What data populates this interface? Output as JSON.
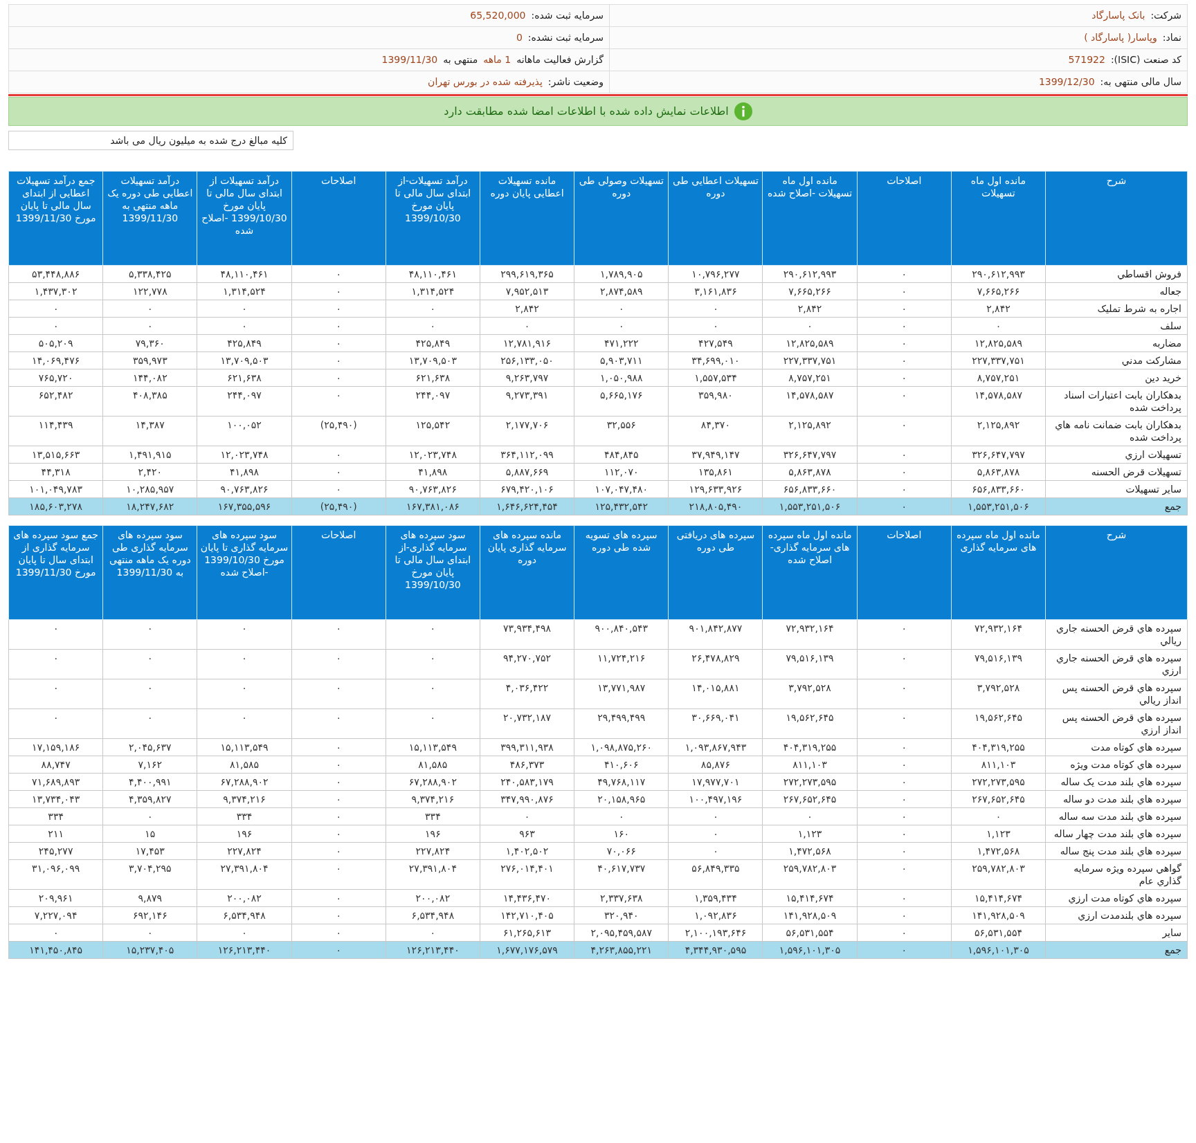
{
  "info": {
    "rows": [
      {
        "right": {
          "label": "شرکت:",
          "parts": [
            {
              "text": "بانک پاسارگاد",
              "emphasis": true
            }
          ]
        },
        "left": {
          "label": "سرمایه ثبت شده:",
          "parts": [
            {
              "text": "65,520,000",
              "emphasis": true
            }
          ]
        }
      },
      {
        "right": {
          "label": "نماد:",
          "parts": [
            {
              "text": "وپاسار( پاسارگاد )",
              "emphasis": true
            }
          ]
        },
        "left": {
          "label": "سرمایه ثبت نشده:",
          "parts": [
            {
              "text": "0",
              "emphasis": true
            }
          ]
        }
      },
      {
        "right": {
          "label": "کد صنعت (ISIC):",
          "parts": [
            {
              "text": "571922",
              "emphasis": true
            }
          ]
        },
        "left": {
          "parts": [
            {
              "text": "گزارش فعالیت ماهانه",
              "emphasis": false
            },
            {
              "text": "1 ماهه",
              "emphasis": true
            },
            {
              "text": "منتهی به",
              "emphasis": false
            },
            {
              "text": "1399/11/30",
              "emphasis": true
            }
          ]
        }
      },
      {
        "right": {
          "label": "سال مالی منتهی به:",
          "parts": [
            {
              "text": "1399/12/30",
              "emphasis": true
            }
          ]
        },
        "left": {
          "label": "وضعیت ناشر:",
          "parts": [
            {
              "text": "پذیرفته شده در بورس تهران",
              "emphasis": true
            }
          ]
        }
      }
    ]
  },
  "banner": {
    "text": "اطلاعات نمایش داده شده با اطلاعات امضا شده مطابقت دارد"
  },
  "note": "کلیه مبالغ درج شده به میلیون ریال می باشد",
  "tables": [
    {
      "columns": [
        "شرح",
        "مانده اول ماه تسهیلات",
        "اصلاحات",
        "مانده اول ماه تسهیلات -اصلاح شده",
        "تسهیلات اعطایی طی دوره",
        "تسهیلات وصولی طی دوره",
        "مانده تسهیلات اعطایی پایان دوره",
        "درآمد تسهیلات-از ابتدای سال مالی تا پایان مورخ 1399/10/30",
        "اصلاحات",
        "درآمد تسهیلات از ابتدای سال مالی تا پایان مورخ 1399/10/30 -اصلاح شده",
        "درآمد تسهیلات اعطایی طی دوره یک ماهه منتهی به 1399/11/30",
        "جمع درآمد تسهیلات اعطایی از ابتدای سال مالی تا پایان مورخ 1399/11/30"
      ],
      "rows": [
        {
          "kind": "data",
          "cells": [
            "فروش اقساطي",
            "۲۹۰,۶۱۲,۹۹۳",
            "۰",
            "۲۹۰,۶۱۲,۹۹۳",
            "۱۰,۷۹۶,۲۷۷",
            "۱,۷۸۹,۹۰۵",
            "۲۹۹,۶۱۹,۳۶۵",
            "۴۸,۱۱۰,۴۶۱",
            "۰",
            "۴۸,۱۱۰,۴۶۱",
            "۵,۳۳۸,۴۲۵",
            "۵۳,۴۴۸,۸۸۶"
          ]
        },
        {
          "kind": "data",
          "cells": [
            "جعاله",
            "۷,۶۶۵,۲۶۶",
            "۰",
            "۷,۶۶۵,۲۶۶",
            "۳,۱۶۱,۸۳۶",
            "۲,۸۷۴,۵۸۹",
            "۷,۹۵۲,۵۱۳",
            "۱,۳۱۴,۵۲۴",
            "۰",
            "۱,۳۱۴,۵۲۴",
            "۱۲۲,۷۷۸",
            "۱,۴۳۷,۳۰۲"
          ]
        },
        {
          "kind": "data",
          "cells": [
            "اجاره به شرط تمليک",
            "۲,۸۴۲",
            "۰",
            "۲,۸۴۲",
            "۰",
            "۰",
            "۲,۸۴۲",
            "۰",
            "۰",
            "۰",
            "۰",
            "۰"
          ]
        },
        {
          "kind": "data",
          "cells": [
            "سلف",
            "۰",
            "۰",
            "۰",
            "۰",
            "۰",
            "۰",
            "۰",
            "۰",
            "۰",
            "۰",
            "۰"
          ]
        },
        {
          "kind": "data",
          "cells": [
            "مضاربه",
            "۱۲,۸۲۵,۵۸۹",
            "۰",
            "۱۲,۸۲۵,۵۸۹",
            "۴۲۷,۵۴۹",
            "۴۷۱,۲۲۲",
            "۱۲,۷۸۱,۹۱۶",
            "۴۲۵,۸۴۹",
            "۰",
            "۴۲۵,۸۴۹",
            "۷۹,۳۶۰",
            "۵۰۵,۲۰۹"
          ]
        },
        {
          "kind": "data",
          "cells": [
            "مشارکت مدني",
            "۲۲۷,۳۳۷,۷۵۱",
            "۰",
            "۲۲۷,۳۳۷,۷۵۱",
            "۳۴,۶۹۹,۰۱۰",
            "۵,۹۰۳,۷۱۱",
            "۲۵۶,۱۳۳,۰۵۰",
            "۱۳,۷۰۹,۵۰۳",
            "۰",
            "۱۳,۷۰۹,۵۰۳",
            "۳۵۹,۹۷۳",
            "۱۴,۰۶۹,۴۷۶"
          ]
        },
        {
          "kind": "data",
          "cells": [
            "خريد دين",
            "۸,۷۵۷,۲۵۱",
            "۰",
            "۸,۷۵۷,۲۵۱",
            "۱,۵۵۷,۵۳۴",
            "۱,۰۵۰,۹۸۸",
            "۹,۲۶۳,۷۹۷",
            "۶۲۱,۶۳۸",
            "۰",
            "۶۲۱,۶۳۸",
            "۱۴۴,۰۸۲",
            "۷۶۵,۷۲۰"
          ]
        },
        {
          "kind": "data",
          "cells": [
            "بدهکاران بابت اعتبارات اسناد پرداخت شده",
            "۱۴,۵۷۸,۵۸۷",
            "۰",
            "۱۴,۵۷۸,۵۸۷",
            "۳۵۹,۹۸۰",
            "۵,۶۶۵,۱۷۶",
            "۹,۲۷۳,۳۹۱",
            "۲۴۴,۰۹۷",
            "۰",
            "۲۴۴,۰۹۷",
            "۴۰۸,۳۸۵",
            "۶۵۲,۴۸۲"
          ]
        },
        {
          "kind": "data",
          "cells": [
            "بدهکاران بابت ضمانت نامه هاي پرداخت شده",
            "۲,۱۲۵,۸۹۲",
            "۰",
            "۲,۱۲۵,۸۹۲",
            "۸۴,۳۷۰",
            "۳۲,۵۵۶",
            "۲,۱۷۷,۷۰۶",
            "۱۲۵,۵۴۲",
            "(۲۵,۴۹۰)",
            "۱۰۰,۰۵۲",
            "۱۴,۳۸۷",
            "۱۱۴,۴۳۹"
          ]
        },
        {
          "kind": "data",
          "cells": [
            "تسهيلات ارزي",
            "۳۲۶,۶۴۷,۷۹۷",
            "۰",
            "۳۲۶,۶۴۷,۷۹۷",
            "۳۷,۹۴۹,۱۴۷",
            "۴۸۴,۸۴۵",
            "۳۶۴,۱۱۲,۰۹۹",
            "۱۲,۰۲۳,۷۴۸",
            "۰",
            "۱۲,۰۲۳,۷۴۸",
            "۱,۴۹۱,۹۱۵",
            "۱۳,۵۱۵,۶۶۳"
          ]
        },
        {
          "kind": "data",
          "cells": [
            "تسهيلات قرض الحسنه",
            "۵,۸۶۳,۸۷۸",
            "۰",
            "۵,۸۶۳,۸۷۸",
            "۱۳۵,۸۶۱",
            "۱۱۲,۰۷۰",
            "۵,۸۸۷,۶۶۹",
            "۴۱,۸۹۸",
            "۰",
            "۴۱,۸۹۸",
            "۲,۴۲۰",
            "۴۴,۳۱۸"
          ]
        },
        {
          "kind": "data",
          "cells": [
            "ساير تسهيلات",
            "۶۵۶,۸۳۳,۶۶۰",
            "۰",
            "۶۵۶,۸۳۳,۶۶۰",
            "۱۲۹,۶۳۳,۹۲۶",
            "۱۰۷,۰۴۷,۴۸۰",
            "۶۷۹,۴۲۰,۱۰۶",
            "۹۰,۷۶۳,۸۲۶",
            "۰",
            "۹۰,۷۶۳,۸۲۶",
            "۱۰,۲۸۵,۹۵۷",
            "۱۰۱,۰۴۹,۷۸۳"
          ]
        },
        {
          "kind": "total",
          "cells": [
            "جمع",
            "۱,۵۵۳,۲۵۱,۵۰۶",
            "۰",
            "۱,۵۵۳,۲۵۱,۵۰۶",
            "۲۱۸,۸۰۵,۴۹۰",
            "۱۲۵,۴۳۲,۵۴۲",
            "۱,۶۴۶,۶۲۴,۴۵۴",
            "۱۶۷,۳۸۱,۰۸۶",
            "(۲۵,۴۹۰)",
            "۱۶۷,۳۵۵,۵۹۶",
            "۱۸,۲۴۷,۶۸۲",
            "۱۸۵,۶۰۳,۲۷۸"
          ]
        }
      ]
    },
    {
      "columns": [
        "شرح",
        "مانده اول ماه سپرده های سرمایه گذاری",
        "اصلاحات",
        "مانده اول ماه سپرده های سرمایه گذاری-اصلاح شده",
        "سپرده های دریافتی طی دوره",
        "سپرده های تسویه شده طی دوره",
        "مانده سپرده های سرمایه گذاری پایان دوره",
        "سود سپرده های سرمایه گذاری-از ابتدای سال مالی تا پایان مورخ 1399/10/30",
        "اصلاحات",
        "سود سپرده های سرمایه گذاری تا پایان مورخ 1399/10/30 -اصلاح شده",
        "سود سپرده های سرمایه گذاری طی دوره یک ماهه منتهی به 1399/11/30",
        "جمع سود سپرده های سرمایه گذاری از ابتدای سال تا پایان مورخ 1399/11/30"
      ],
      "rows": [
        {
          "kind": "data",
          "cells": [
            "سپرده هاي قرض الحسنه جاري ريالي",
            "۷۲,۹۳۲,۱۶۴",
            "۰",
            "۷۲,۹۳۲,۱۶۴",
            "۹۰۱,۸۴۲,۸۷۷",
            "۹۰۰,۸۴۰,۵۴۳",
            "۷۳,۹۳۴,۴۹۸",
            "۰",
            "۰",
            "۰",
            "۰",
            "۰"
          ]
        },
        {
          "kind": "data",
          "cells": [
            "سپرده هاي قرض الحسنه جاري ارزي",
            "۷۹,۵۱۶,۱۳۹",
            "۰",
            "۷۹,۵۱۶,۱۳۹",
            "۲۶,۴۷۸,۸۲۹",
            "۱۱,۷۲۴,۲۱۶",
            "۹۴,۲۷۰,۷۵۲",
            "۰",
            "۰",
            "۰",
            "۰",
            "۰"
          ]
        },
        {
          "kind": "data",
          "cells": [
            "سپرده هاي قرض الحسنه پس انداز ريالي",
            "۳,۷۹۲,۵۲۸",
            "۰",
            "۳,۷۹۲,۵۲۸",
            "۱۴,۰۱۵,۸۸۱",
            "۱۳,۷۷۱,۹۸۷",
            "۴,۰۳۶,۴۲۲",
            "۰",
            "۰",
            "۰",
            "۰",
            "۰"
          ]
        },
        {
          "kind": "data",
          "cells": [
            "سپرده هاي قرض الحسنه پس انداز ارزي",
            "۱۹,۵۶۲,۶۴۵",
            "۰",
            "۱۹,۵۶۲,۶۴۵",
            "۳۰,۶۶۹,۰۴۱",
            "۲۹,۴۹۹,۴۹۹",
            "۲۰,۷۳۲,۱۸۷",
            "۰",
            "۰",
            "۰",
            "۰",
            "۰"
          ]
        },
        {
          "kind": "data",
          "cells": [
            "سپرده هاي کوتاه مدت",
            "۴۰۴,۳۱۹,۲۵۵",
            "۰",
            "۴۰۴,۳۱۹,۲۵۵",
            "۱,۰۹۳,۸۶۷,۹۴۳",
            "۱,۰۹۸,۸۷۵,۲۶۰",
            "۳۹۹,۳۱۱,۹۳۸",
            "۱۵,۱۱۳,۵۴۹",
            "۰",
            "۱۵,۱۱۳,۵۴۹",
            "۲,۰۴۵,۶۳۷",
            "۱۷,۱۵۹,۱۸۶"
          ]
        },
        {
          "kind": "data",
          "cells": [
            "سپرده هاي کوتاه مدت ويژه",
            "۸۱۱,۱۰۳",
            "۰",
            "۸۱۱,۱۰۳",
            "۸۵,۸۷۶",
            "۴۱۰,۶۰۶",
            "۴۸۶,۳۷۳",
            "۸۱,۵۸۵",
            "۰",
            "۸۱,۵۸۵",
            "۷,۱۶۲",
            "۸۸,۷۴۷"
          ]
        },
        {
          "kind": "data",
          "cells": [
            "سپرده هاي بلند مدت يک ساله",
            "۲۷۲,۲۷۳,۵۹۵",
            "۰",
            "۲۷۲,۲۷۳,۵۹۵",
            "۱۷,۹۷۷,۷۰۱",
            "۴۹,۷۶۸,۱۱۷",
            "۲۴۰,۵۸۳,۱۷۹",
            "۶۷,۲۸۸,۹۰۲",
            "۰",
            "۶۷,۲۸۸,۹۰۲",
            "۴,۴۰۰,۹۹۱",
            "۷۱,۶۸۹,۸۹۳"
          ]
        },
        {
          "kind": "data",
          "cells": [
            "سپرده هاي بلند مدت دو ساله",
            "۲۶۷,۶۵۲,۶۴۵",
            "۰",
            "۲۶۷,۶۵۲,۶۴۵",
            "۱۰۰,۴۹۷,۱۹۶",
            "۲۰,۱۵۸,۹۶۵",
            "۳۴۷,۹۹۰,۸۷۶",
            "۹,۳۷۴,۲۱۶",
            "۰",
            "۹,۳۷۴,۲۱۶",
            "۴,۳۵۹,۸۲۷",
            "۱۳,۷۳۴,۰۴۳"
          ]
        },
        {
          "kind": "data",
          "cells": [
            "سپرده هاي بلند مدت سه ساله",
            "۰",
            "۰",
            "۰",
            "۰",
            "۰",
            "۰",
            "۳۳۴",
            "۰",
            "۳۳۴",
            "۰",
            "۳۳۴"
          ]
        },
        {
          "kind": "data",
          "cells": [
            "سپرده هاي بلند مدت چهار ساله",
            "۱,۱۲۳",
            "۰",
            "۱,۱۲۳",
            "۰",
            "۱۶۰",
            "۹۶۳",
            "۱۹۶",
            "۰",
            "۱۹۶",
            "۱۵",
            "۲۱۱"
          ]
        },
        {
          "kind": "data",
          "cells": [
            "سپرده هاي بلند مدت پنج ساله",
            "۱,۴۷۲,۵۶۸",
            "۰",
            "۱,۴۷۲,۵۶۸",
            "۰",
            "۷۰,۰۶۶",
            "۱,۴۰۲,۵۰۲",
            "۲۲۷,۸۲۴",
            "۰",
            "۲۲۷,۸۲۴",
            "۱۷,۴۵۳",
            "۲۴۵,۲۷۷"
          ]
        },
        {
          "kind": "data",
          "cells": [
            "گواهي سپرده ويژه سرمايه گذاري عام",
            "۲۵۹,۷۸۲,۸۰۳",
            "۰",
            "۲۵۹,۷۸۲,۸۰۳",
            "۵۶,۸۴۹,۳۳۵",
            "۴۰,۶۱۷,۷۳۷",
            "۲۷۶,۰۱۴,۴۰۱",
            "۲۷,۳۹۱,۸۰۴",
            "۰",
            "۲۷,۳۹۱,۸۰۴",
            "۳,۷۰۴,۲۹۵",
            "۳۱,۰۹۶,۰۹۹"
          ]
        },
        {
          "kind": "data",
          "cells": [
            "سپرده هاي کوتاه مدت ارزي",
            "۱۵,۴۱۴,۶۷۴",
            "۰",
            "۱۵,۴۱۴,۶۷۴",
            "۱,۳۵۹,۴۳۴",
            "۲,۳۳۷,۶۳۸",
            "۱۴,۴۳۶,۴۷۰",
            "۲۰۰,۰۸۲",
            "۰",
            "۲۰۰,۰۸۲",
            "۹,۸۷۹",
            "۲۰۹,۹۶۱"
          ]
        },
        {
          "kind": "data",
          "cells": [
            "سپرده هاي بلندمدت ارزي",
            "۱۴۱,۹۲۸,۵۰۹",
            "۰",
            "۱۴۱,۹۲۸,۵۰۹",
            "۱,۰۹۲,۸۳۶",
            "۳۲۰,۹۴۰",
            "۱۴۲,۷۱۰,۴۰۵",
            "۶,۵۳۴,۹۴۸",
            "۰",
            "۶,۵۳۴,۹۴۸",
            "۶۹۲,۱۴۶",
            "۷,۲۲۷,۰۹۴"
          ]
        },
        {
          "kind": "data",
          "cells": [
            "ساير",
            "۵۶,۵۳۱,۵۵۴",
            "۰",
            "۵۶,۵۳۱,۵۵۴",
            "۲,۱۰۰,۱۹۳,۶۴۶",
            "۲,۰۹۵,۴۵۹,۵۸۷",
            "۶۱,۲۶۵,۶۱۳",
            "۰",
            "۰",
            "۰",
            "۰",
            "۰"
          ]
        },
        {
          "kind": "total",
          "cells": [
            "جمع",
            "۱,۵۹۶,۱۰۱,۳۰۵",
            "۰",
            "۱,۵۹۶,۱۰۱,۳۰۵",
            "۴,۳۴۴,۹۳۰,۵۹۵",
            "۴,۲۶۳,۸۵۵,۲۲۱",
            "۱,۶۷۷,۱۷۶,۵۷۹",
            "۱۲۶,۲۱۳,۴۴۰",
            "۰",
            "۱۲۶,۲۱۳,۴۴۰",
            "۱۵,۲۳۷,۴۰۵",
            "۱۴۱,۴۵۰,۸۴۵"
          ]
        }
      ]
    }
  ]
}
